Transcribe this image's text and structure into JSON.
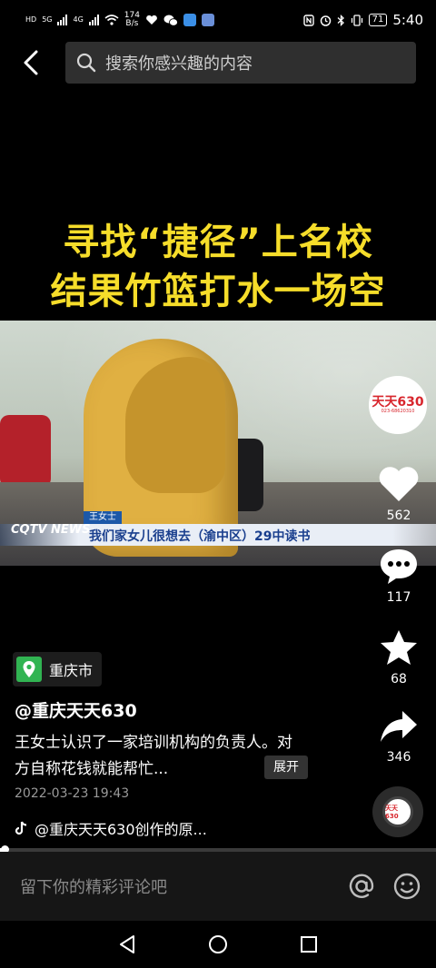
{
  "status_bar": {
    "network_labels": [
      "HD",
      "5G",
      "4G"
    ],
    "net_speed_value": "174",
    "net_speed_unit": "B/s",
    "battery": "71",
    "time": "5:40"
  },
  "search": {
    "placeholder": "搜索你感兴趣的内容"
  },
  "video": {
    "headline_line1": "寻找“捷径”上名校",
    "headline_line2": "结果竹篮打水一场空",
    "lower_third_tag": "王女士",
    "lower_third_text": "我们家女儿很想去（渝中区）29中读书",
    "channel_logo": "CQTV NEWS",
    "progress": 0.01
  },
  "avatar": {
    "logo_text": "天天630",
    "subtext": "023-68620310"
  },
  "actions": {
    "likes": "562",
    "comments": "117",
    "favorites": "68",
    "shares": "346"
  },
  "post": {
    "location": "重庆市",
    "author": "@重庆天天630",
    "description": "王女士认识了一家培训机构的负责人。对方自称花钱就能帮忙...",
    "expand_label": "展开",
    "date": "2022-03-23 19:43",
    "music": "@重庆天天630创作的原..."
  },
  "comment_bar": {
    "placeholder": "留下你的精彩评论吧"
  },
  "colors": {
    "headline_yellow": "#f6dd2a",
    "location_green": "#31b452",
    "brand_red": "#d8262d"
  }
}
